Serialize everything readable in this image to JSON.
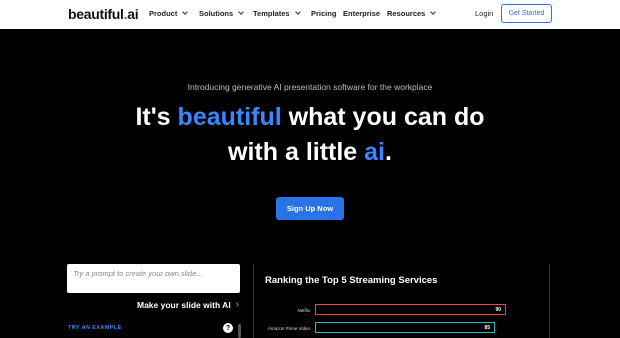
{
  "header": {
    "logo": {
      "main": "beautiful",
      "dot": ".",
      "ai": "ai"
    },
    "nav": [
      {
        "label": "Product",
        "dropdown": true
      },
      {
        "label": "Solutions",
        "dropdown": true
      },
      {
        "label": "Templates",
        "dropdown": true
      },
      {
        "label": "Pricing",
        "dropdown": false
      },
      {
        "label": "Enterprise",
        "dropdown": false
      },
      {
        "label": "Resources",
        "dropdown": true
      }
    ],
    "login_label": "Login",
    "get_started_label": "Get Started"
  },
  "hero": {
    "intro": "Introducing generative AI presentation software for the workplace",
    "line1_pre": "It's ",
    "line1_highlight": "beautiful",
    "line1_post": " what you can do",
    "line2_pre": "with a little ",
    "line2_highlight": "ai",
    "line2_post": ".",
    "signup_label": "Sign Up Now"
  },
  "prompt": {
    "placeholder": "Try a prompt to create your own slide...",
    "make_slide_label": "Make your slide with AI",
    "arrow": "›",
    "try_example_label": "TRY AN EXAMPLE",
    "help_icon": "?"
  },
  "slide": {
    "title": "Ranking the Top 5 Streaming Services",
    "bars": [
      {
        "label": "Netflix",
        "value": "90",
        "color": "#e24a3a"
      },
      {
        "label": "Amazon Prime Video",
        "value": "85",
        "color": "#2ab3c7"
      }
    ]
  },
  "colors": {
    "accent": "#2a72e8",
    "highlight": "#3a86ff"
  }
}
